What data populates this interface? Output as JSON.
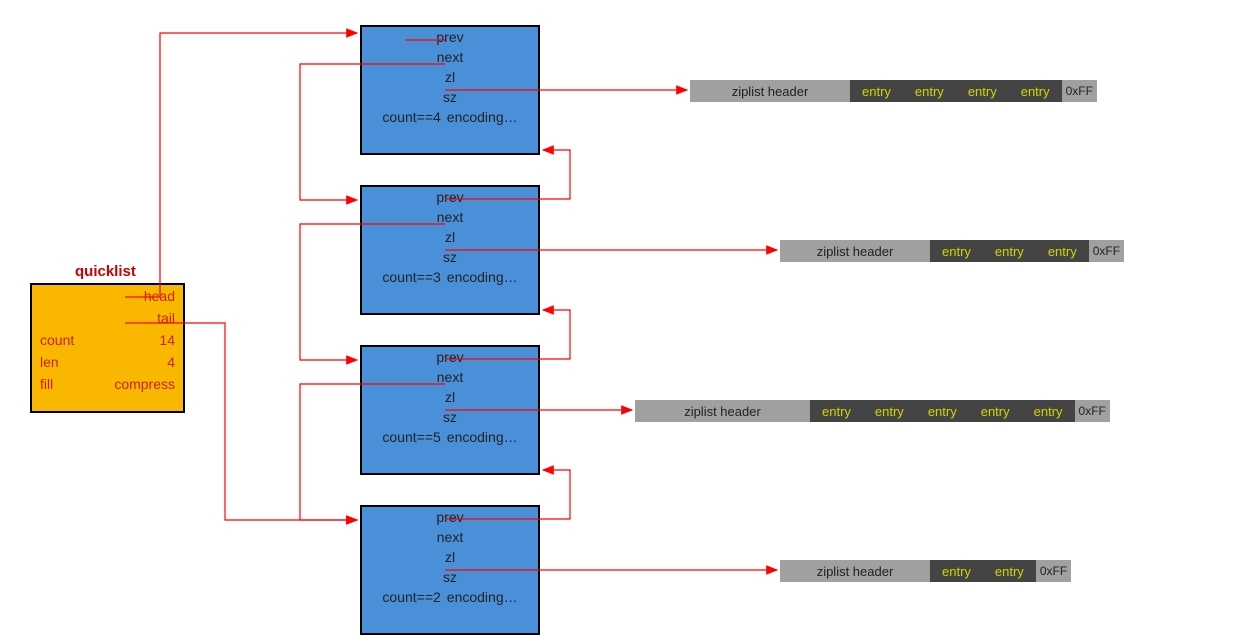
{
  "quicklist": {
    "title": "quicklist",
    "head_label": "head",
    "tail_label": "tail",
    "count_label": "count",
    "count_value": "14",
    "len_label": "len",
    "len_value": "4",
    "fill_label": "fill",
    "compress_label": "compress"
  },
  "node": {
    "prev": "prev",
    "next": "next",
    "zl": "zl",
    "sz": "sz",
    "count1": "count==4",
    "count2": "count==3",
    "count3": "count==5",
    "count4": "count==2",
    "encoding": "encoding…"
  },
  "ziplist": {
    "header": "ziplist header",
    "entry": "entry",
    "end": "0xFF"
  },
  "chart_data": {
    "type": "table",
    "title": "quicklist structure with 4 nodes pointing to ziplists",
    "quicklist": {
      "count": 14,
      "len": 4,
      "fill": null,
      "compress": null
    },
    "nodes": [
      {
        "count": 4,
        "ziplist_entries": 4
      },
      {
        "count": 3,
        "ziplist_entries": 3
      },
      {
        "count": 5,
        "ziplist_entries": 5
      },
      {
        "count": 2,
        "ziplist_entries": 2
      }
    ],
    "ziplist_end_marker": "0xFF"
  }
}
